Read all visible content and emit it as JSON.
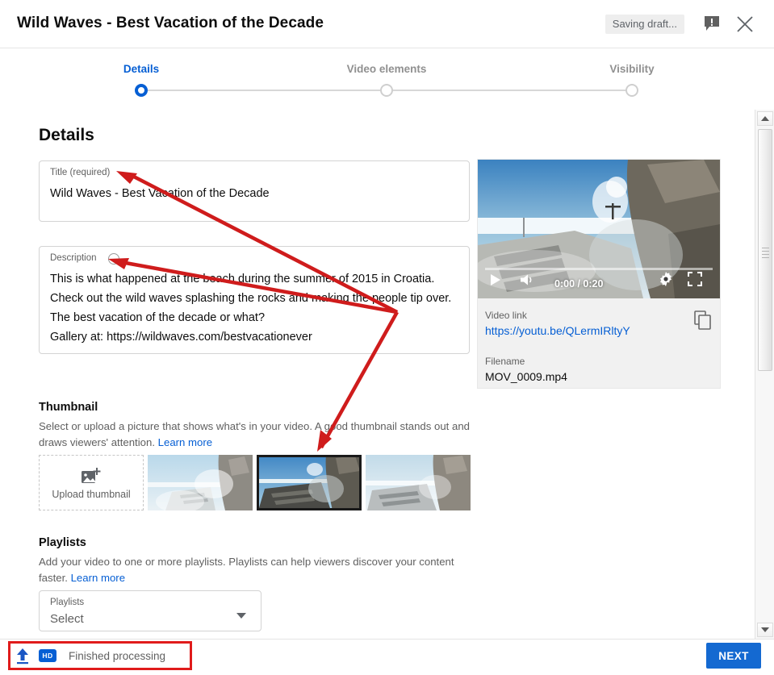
{
  "header": {
    "title": "Wild Waves - Best Vacation of the Decade",
    "saving_status": "Saving draft...",
    "feedback_icon": "feedback-exclamation-icon",
    "close_icon": "close-icon"
  },
  "stepper": {
    "steps": [
      {
        "label": "Details",
        "state": "active"
      },
      {
        "label": "Video elements",
        "state": "inactive"
      },
      {
        "label": "Visibility",
        "state": "inactive"
      }
    ]
  },
  "details": {
    "heading": "Details",
    "title_field": {
      "label": "Title (required)",
      "value": "Wild Waves - Best Vacation of the Decade"
    },
    "description_field": {
      "label": "Description",
      "help_icon": "help-circle-icon",
      "value": "This is what happened at the beach during the summer of 2015 in Croatia. Check out the wild waves splashing the rocks and making the people tip over. The best vacation of the decade or what?\nGallery at: https://wildwaves.com/bestvacationever"
    }
  },
  "thumbnail": {
    "heading": "Thumbnail",
    "helper_line1": "Select or upload a picture that shows what's in your video. A good thumbnail stands out and",
    "helper_line2": "draws viewers' attention.",
    "learn_more": "Learn more",
    "upload_label": "Upload thumbnail",
    "upload_icon": "add-image-icon",
    "options": [
      {
        "name": "thumbnail-option-1",
        "selected": false
      },
      {
        "name": "thumbnail-option-2",
        "selected": true
      },
      {
        "name": "thumbnail-option-3",
        "selected": false
      }
    ]
  },
  "playlists": {
    "heading": "Playlists",
    "helper_line1": "Add your video to one or more playlists. Playlists can help viewers discover your content",
    "helper_line2": "faster.",
    "learn_more": "Learn more",
    "select_label": "Playlists",
    "select_value": "Select"
  },
  "video_card": {
    "player": {
      "play_icon": "play-icon",
      "volume_icon": "volume-icon",
      "time": "0:00 / 0:20",
      "settings_icon": "gear-icon",
      "fullscreen_icon": "fullscreen-icon"
    },
    "video_link_label": "Video link",
    "video_link_value": "https://youtu.be/QLermIRltyY",
    "copy_icon": "copy-icon",
    "filename_label": "Filename",
    "filename_value": "MOV_0009.mp4"
  },
  "footer": {
    "upload_icon": "upload-icon",
    "hd_badge": "HD",
    "status": "Finished processing",
    "next_label": "NEXT"
  },
  "colors": {
    "accent_blue": "#065fd4",
    "next_button": "#1469d1",
    "annotation_red": "#cf1c1c",
    "text_primary": "#0d0d0d",
    "text_secondary": "#606060"
  }
}
